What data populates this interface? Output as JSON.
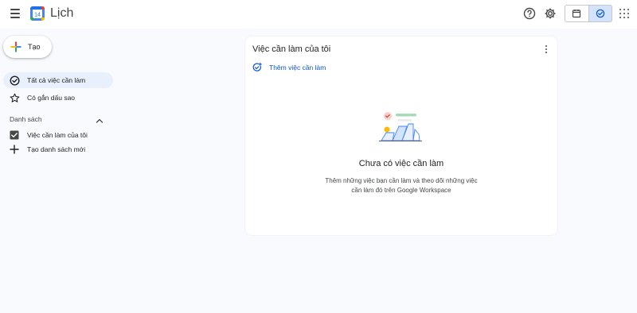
{
  "header": {
    "app_title": "Lịch",
    "logo_day": "14",
    "icons": [
      "menu-icon",
      "help-icon",
      "settings-icon",
      "calendar-icon",
      "tasks-icon",
      "apps-icon"
    ]
  },
  "sidebar": {
    "create_label": "Tạo",
    "nav": [
      {
        "label": "Tất cả việc cần làm",
        "icon": "check-circle-icon",
        "active": true
      },
      {
        "label": "Có gắn dấu sao",
        "icon": "star-icon",
        "active": false
      }
    ],
    "section_title": "Danh sách",
    "lists": [
      {
        "label": "Việc cần làm của tôi",
        "icon": "checkbox-icon",
        "checked": true
      },
      {
        "label": "Tạo danh sách mới",
        "icon": "plus-icon"
      }
    ]
  },
  "panel": {
    "title": "Việc cần làm của tôi",
    "add_task_label": "Thêm việc cần làm",
    "empty_title": "Chưa có việc cần làm",
    "empty_desc": "Thêm những việc bạn cần làm và theo dõi những việc cần làm đó trên Google Workspace"
  },
  "colors": {
    "accent": "#0b57d0",
    "active_bg": "#e8f0fe",
    "page_bg": "#f8fafd"
  }
}
